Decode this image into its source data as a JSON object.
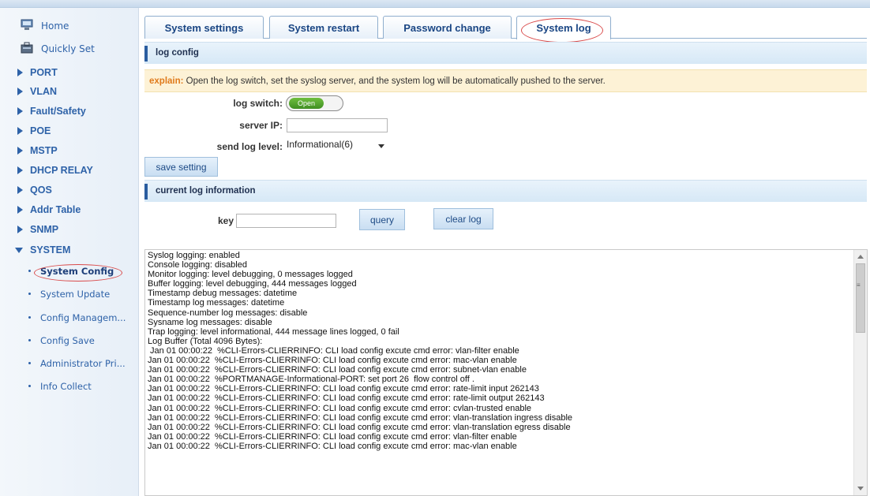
{
  "sidebar": {
    "home": "Home",
    "quickly_set": "Quickly Set",
    "sections": [
      "PORT",
      "VLAN",
      "Fault/Safety",
      "POE",
      "MSTP",
      "DHCP RELAY",
      "QOS",
      "Addr Table",
      "SNMP"
    ],
    "system": "SYSTEM",
    "system_items": [
      "System Config",
      "System Update",
      "Config Managem...",
      "Config Save",
      "Administrator Pri...",
      "Info Collect"
    ]
  },
  "tabs": [
    "System settings",
    "System restart",
    "Password change",
    "System log"
  ],
  "log_config": {
    "title": "log config",
    "explain_label": "explain:",
    "explain_text": "Open the log switch, set the syslog server, and the system log will be automatically pushed to the server.",
    "log_switch_label": "log switch:",
    "log_switch_value": "Open",
    "server_ip_label": "server IP:",
    "server_ip_value": "",
    "send_level_label": "send log level:",
    "send_level_value": "Informational(6)",
    "save_button": "save setting"
  },
  "current_log": {
    "title": "current log information",
    "key_label": "key",
    "key_value": "",
    "query_button": "query",
    "clear_button": "clear log",
    "lines": [
      "Syslog logging: enabled",
      "Console logging: disabled",
      "Monitor logging: level debugging, 0 messages logged",
      "Buffer logging: level debugging, 444 messages logged",
      "Timestamp debug messages: datetime",
      "Timestamp log messages: datetime",
      "Sequence-number log messages: disable",
      "Sysname log messages: disable",
      "Trap logging: level informational, 444 message lines logged, 0 fail",
      "Log Buffer (Total 4096 Bytes):",
      " Jan 01 00:00:22  %CLI-Errors-CLIERRINFO: CLI load config excute cmd error: vlan-filter enable",
      "Jan 01 00:00:22  %CLI-Errors-CLIERRINFO: CLI load config excute cmd error: mac-vlan enable",
      "Jan 01 00:00:22  %CLI-Errors-CLIERRINFO: CLI load config excute cmd error: subnet-vlan enable",
      "Jan 01 00:00:22  %PORTMANAGE-Informational-PORT: set port 26  flow control off .",
      "Jan 01 00:00:22  %CLI-Errors-CLIERRINFO: CLI load config excute cmd error: rate-limit input 262143",
      "Jan 01 00:00:22  %CLI-Errors-CLIERRINFO: CLI load config excute cmd error: rate-limit output 262143",
      "Jan 01 00:00:22  %CLI-Errors-CLIERRINFO: CLI load config excute cmd error: cvlan-trusted enable",
      "Jan 01 00:00:22  %CLI-Errors-CLIERRINFO: CLI load config excute cmd error: vlan-translation ingress disable",
      "Jan 01 00:00:22  %CLI-Errors-CLIERRINFO: CLI load config excute cmd error: vlan-translation egress disable",
      "Jan 01 00:00:22  %CLI-Errors-CLIERRINFO: CLI load config excute cmd error: vlan-filter enable",
      "Jan 01 00:00:22  %CLI-Errors-CLIERRINFO: CLI load config excute cmd error: mac-vlan enable"
    ]
  },
  "colors": {
    "accent": "#2e62a8",
    "highlight_oval": "#d94a4a",
    "explain_bg": "#fdf2d6",
    "switch_on": "#4f9e2c"
  }
}
